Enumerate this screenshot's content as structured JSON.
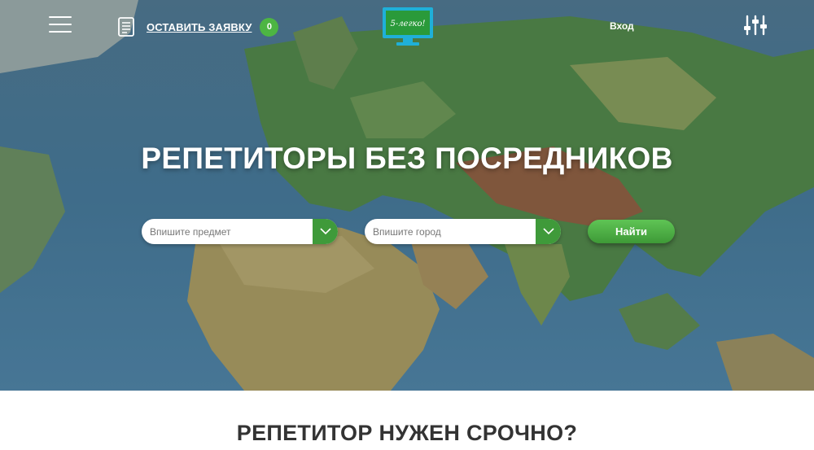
{
  "header": {
    "request_label": "ОСТАВИТЬ ЗАЯВКУ",
    "request_count": "0",
    "logo_text": "5-легко!",
    "login_label": "Вход",
    "icons": {
      "menu": "hamburger-menu-icon",
      "request": "document-icon",
      "filters": "sliders-icon"
    }
  },
  "hero": {
    "title": "РЕПЕТИТОРЫ БЕЗ ПОСРЕДНИКОВ",
    "subject_placeholder": "Впишите предмет",
    "city_placeholder": "Впишите город",
    "search_label": "Найти"
  },
  "section": {
    "title": "РЕПЕТИТОР НУЖЕН СРОЧНО?"
  },
  "colors": {
    "accent_green": "#4db543",
    "dropdown_green": "#3f9a3a",
    "text_dark": "#333333"
  }
}
